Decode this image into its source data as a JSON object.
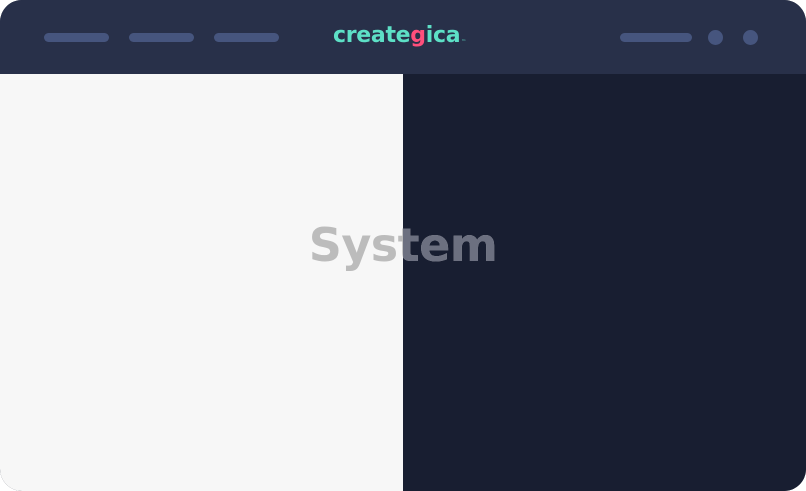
{
  "brand": {
    "name_part1": "create",
    "name_part2": "g",
    "name_part3": "ica",
    "trademark": "™",
    "primary_color": "#5de0c6",
    "accent_color": "#ff4f7c"
  },
  "theme_preview": {
    "label": "System",
    "light_side_color": "#f7f7f7",
    "dark_side_color": "#181e31"
  },
  "colors": {
    "topbar": "#283049",
    "placeholder": "#46557e"
  },
  "topbar": {
    "nav_items": [
      "nav-placeholder",
      "nav-placeholder",
      "nav-placeholder"
    ],
    "actions": [
      "action-placeholder",
      "dot-placeholder",
      "dot-placeholder"
    ]
  }
}
